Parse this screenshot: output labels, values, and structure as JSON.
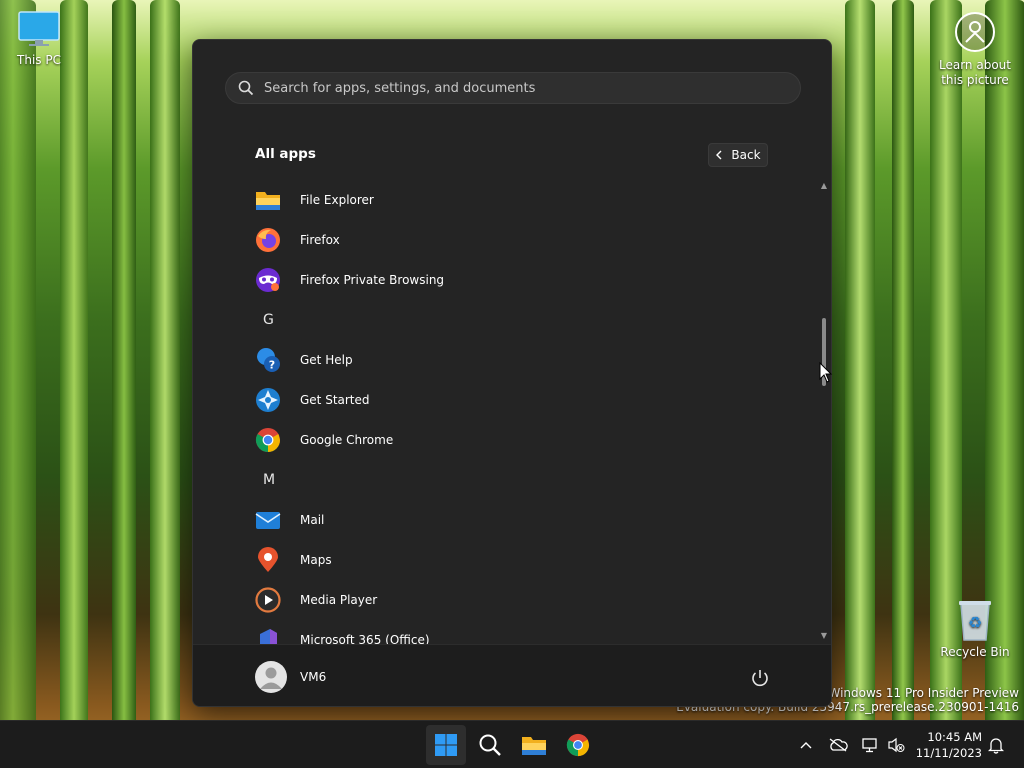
{
  "desktop": {
    "icons": [
      {
        "label": "This PC"
      },
      {
        "label": "Recycle Bin"
      }
    ],
    "spotlight": {
      "line1": "Learn about",
      "line2": "this picture"
    },
    "watermark": {
      "line1": "Windows 11 Pro Insider Preview",
      "line2": "Evaluation copy. Build 25947.rs_prerelease.230901-1416"
    }
  },
  "start_menu": {
    "search": {
      "placeholder": "Search for apps, settings, and documents"
    },
    "section_title": "All apps",
    "back_label": "Back",
    "items": [
      {
        "kind": "app",
        "label": "File Explorer",
        "icon": "file-explorer-icon"
      },
      {
        "kind": "app",
        "label": "Firefox",
        "icon": "firefox-icon"
      },
      {
        "kind": "app",
        "label": "Firefox Private Browsing",
        "icon": "firefox-private-icon"
      },
      {
        "kind": "letter",
        "label": "G"
      },
      {
        "kind": "app",
        "label": "Get Help",
        "icon": "get-help-icon"
      },
      {
        "kind": "app",
        "label": "Get Started",
        "icon": "get-started-icon"
      },
      {
        "kind": "app",
        "label": "Google Chrome",
        "icon": "chrome-icon"
      },
      {
        "kind": "letter",
        "label": "M"
      },
      {
        "kind": "app",
        "label": "Mail",
        "icon": "mail-icon"
      },
      {
        "kind": "app",
        "label": "Maps",
        "icon": "maps-icon"
      },
      {
        "kind": "app",
        "label": "Media Player",
        "icon": "media-player-icon"
      },
      {
        "kind": "app",
        "label": "Microsoft 365 (Office)",
        "icon": "office-icon"
      }
    ],
    "user": {
      "name": "VM6"
    }
  },
  "taskbar": {
    "clock": {
      "time": "10:45 AM",
      "date": "11/11/2023"
    }
  },
  "colors": {
    "menu_bg": "#242424",
    "taskbar_bg": "#1c1c1c",
    "accent_blue": "#1e90ff"
  }
}
